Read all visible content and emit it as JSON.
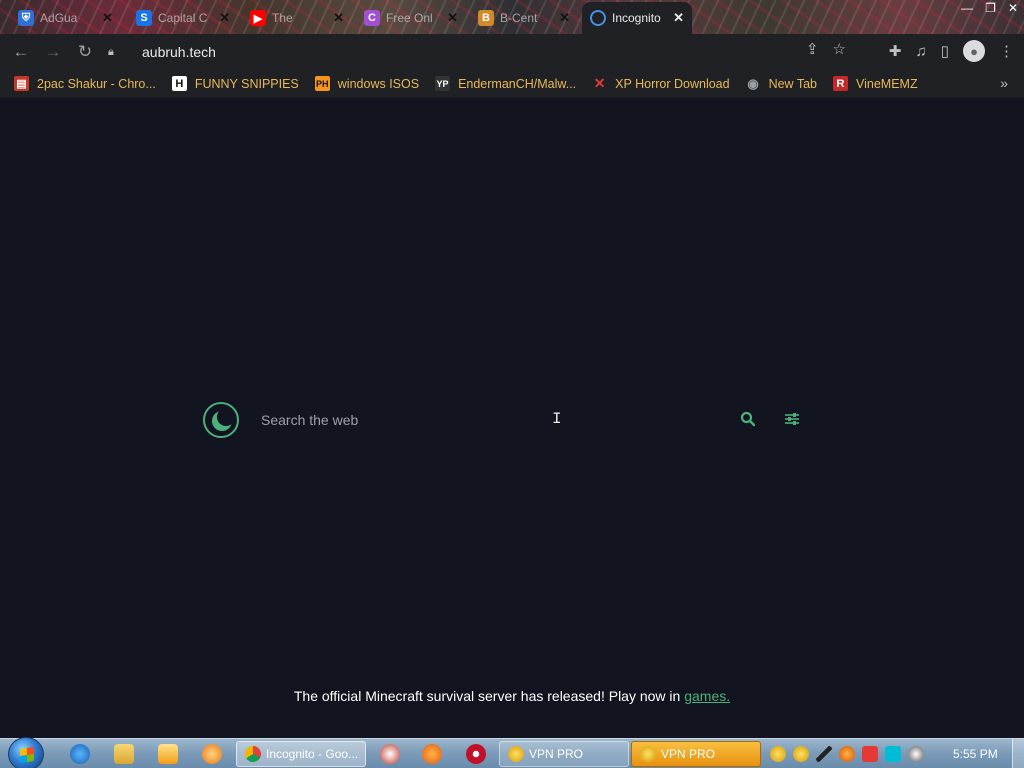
{
  "tabs": [
    {
      "title": "AdGua",
      "favicon": "shield-icon",
      "color": "#2e6fd8"
    },
    {
      "title": "Capital C",
      "favicon": "s-icon",
      "color": "#1a73e8"
    },
    {
      "title": "The",
      "favicon": "youtube-icon",
      "color": "#ff0000"
    },
    {
      "title": "Free Onl",
      "favicon": "c-icon",
      "color": "#a14fd3"
    },
    {
      "title": "B-Cent",
      "favicon": "b-icon",
      "color": "#d08a2a"
    },
    {
      "title": "Incognito",
      "favicon": "moon-icon",
      "color": "#4a90e2",
      "active": true
    }
  ],
  "toolbar": {
    "url": "aubruh.tech"
  },
  "bookmarks": [
    {
      "label": "2pac Shakur - Chro...",
      "icon": "store-icon",
      "color": "#c0392b"
    },
    {
      "label": "FUNNY SNIPPIES",
      "icon": "h-icon",
      "color": "#ffffff"
    },
    {
      "label": "windows ISOS",
      "icon": "ph-icon",
      "color": "#f7941d"
    },
    {
      "label": "EndermanCH/Malw...",
      "icon": "yp-icon",
      "color": "#333333"
    },
    {
      "label": "XP Horror Download",
      "icon": "x-icon",
      "color": "#e53935"
    },
    {
      "label": "New Tab",
      "icon": "globe-icon",
      "color": "#9aa0a6"
    },
    {
      "label": "VineMEMZ",
      "icon": "r-icon",
      "color": "#c62828"
    }
  ],
  "search": {
    "placeholder": "Search the web"
  },
  "notice": {
    "text": "The official Minecraft survival server has released! Play now in ",
    "link": "games."
  },
  "taskbar": {
    "chrome_task": "Incognito - Goo...",
    "vpn1": "VPN PRO",
    "vpn2": "VPN PRO",
    "clock": "5:55 PM"
  },
  "colors": {
    "accent": "#4caf7d",
    "page_bg": "#12151f",
    "bookmark_text": "#e8b95a"
  }
}
